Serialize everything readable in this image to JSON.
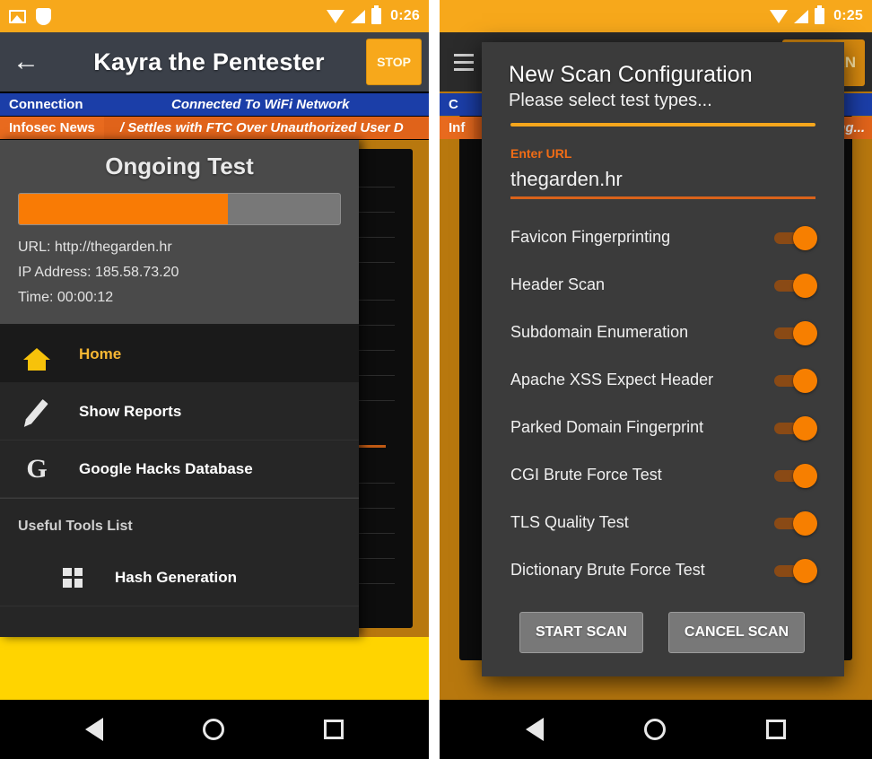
{
  "left_phone": {
    "status_bar": {
      "icons": [
        "photo-icon",
        "shield-icon",
        "wifi-icon",
        "signal-icon",
        "battery-icon"
      ],
      "clock": "0:26"
    },
    "toolbar": {
      "back_icon": "←",
      "title": "Kayra the Pentester",
      "stop_label": "STOP"
    },
    "tickers": [
      {
        "tag": "Connection",
        "message": "Connected To WiFi Network"
      },
      {
        "tag": "Infosec News",
        "message": "/ Settles with FTC Over Unauthorized User D"
      }
    ],
    "drawer": {
      "header_title": "Ongoing Test",
      "progress_percent": 65,
      "url_line": "URL: http://thegarden.hr",
      "ip_line": "IP Address: 185.58.73.20",
      "time_line": "Time: 00:00:12",
      "items": [
        {
          "label": "Home",
          "icon": "home-icon",
          "active": true
        },
        {
          "label": "Show Reports",
          "icon": "pencil-icon",
          "active": false
        },
        {
          "label": "Google Hacks Database",
          "icon": "google-icon",
          "active": false
        }
      ],
      "section_title": "Useful Tools List",
      "tools": [
        {
          "label": "Hash Generation",
          "icon": "grid-icon"
        }
      ]
    },
    "navbar": {
      "back": "nav-back-icon",
      "home": "nav-home-icon",
      "recents": "nav-recents-icon"
    }
  },
  "right_phone": {
    "status_bar": {
      "icons": [
        "wifi-icon",
        "signal-icon",
        "battery-icon"
      ],
      "clock": "0:25"
    },
    "toolbar": {
      "menu_icon": "hamburger-icon",
      "scan_label": "AN"
    },
    "tickers": [
      {
        "tag": "C",
        "message": ""
      },
      {
        "tag": "Inf",
        "message": "ing..."
      }
    ],
    "dialog": {
      "title": "New Scan Configuration",
      "subtitle": "Please select test types...",
      "url_field_label": "Enter URL",
      "url_field_value": "thegarden.hr",
      "tests": [
        {
          "label": "Favicon Fingerprinting",
          "enabled": true
        },
        {
          "label": "Header Scan",
          "enabled": true
        },
        {
          "label": "Subdomain Enumeration",
          "enabled": true
        },
        {
          "label": "Apache XSS Expect Header",
          "enabled": true
        },
        {
          "label": "Parked Domain Fingerprint",
          "enabled": true
        },
        {
          "label": "CGI Brute Force Test",
          "enabled": true
        },
        {
          "label": "TLS Quality Test",
          "enabled": true
        },
        {
          "label": "Dictionary Brute Force Test",
          "enabled": true
        }
      ],
      "start_label": "START SCAN",
      "cancel_label": "CANCEL SCAN"
    }
  },
  "colors": {
    "accent_orange": "#f7a81b",
    "progress_orange": "#f97b05",
    "toggle_on": "#f77f00",
    "connection_blue": "#1b3ea8",
    "news_orange": "#e86a1e",
    "toolbar_dark": "#3b4049",
    "drawer_dark": "#262626",
    "footer_yellow": "#ffd400"
  }
}
